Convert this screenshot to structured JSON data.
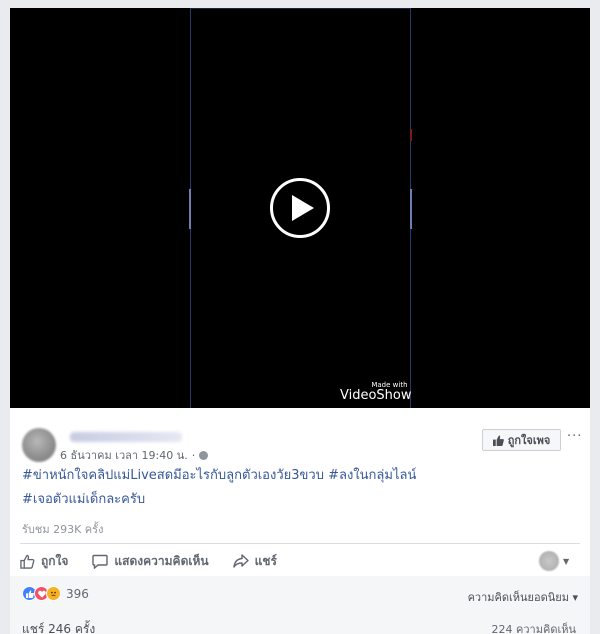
{
  "video": {
    "watermark_small": "Made with",
    "watermark_big": "VideoShow"
  },
  "post": {
    "timestamp": "6 ธันวาคม เวลา 19:40 น.",
    "dot": "·",
    "caption_line1": "#ข่าหนักใจคลิปแม่Liveสดมีอะไรกับลูกตัวเองวัย3ขวบ #ลงในกลุ่มไลน์",
    "caption_line2": "#เจอตัวแม่เด็กละครับ",
    "views": "รับชม 293K ครั้ง",
    "like_page_label": "ถูกใจเพจ",
    "more_label": "···"
  },
  "actions": {
    "like": "ถูกใจ",
    "comment": "แสดงความคิดเห็น",
    "share": "แชร์"
  },
  "summary": {
    "reaction_count": "396",
    "sort_label": "ความคิดเห็นยอดนิยม ▾",
    "shares": "แชร์ 246 ครั้ง",
    "comments": "224 ความคิดเห็น"
  },
  "colors": {
    "link": "#365899",
    "like_reaction": "#4080ff",
    "love_reaction": "#f25268",
    "sad_reaction": "#f7b125"
  }
}
